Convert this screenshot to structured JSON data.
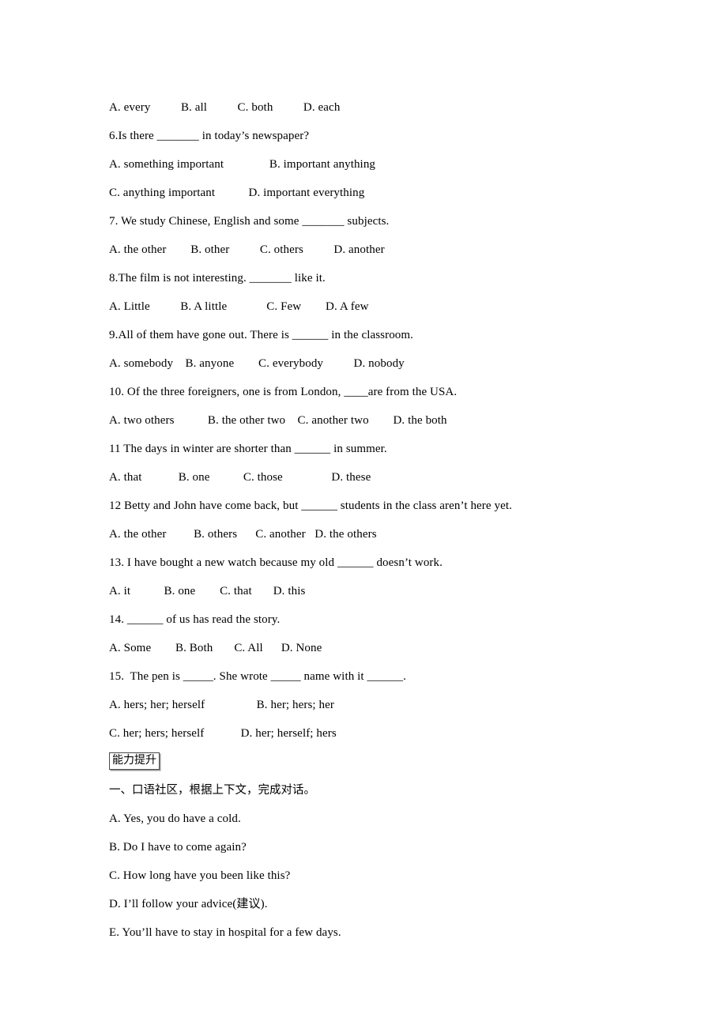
{
  "document": {
    "type": "english-grammar-worksheet",
    "background": "#ffffff",
    "text_color": "#000000"
  },
  "questions": [
    {
      "id": "q5-options",
      "kind": "options",
      "text": "A. every          B. all          C. both          D. each"
    },
    {
      "id": "q6",
      "kind": "stem",
      "text": "6.Is there _______ in today’s newspaper?"
    },
    {
      "id": "q6-options-1",
      "kind": "options",
      "text": "A. something important               B. important anything"
    },
    {
      "id": "q6-options-2",
      "kind": "options",
      "text": "C. anything important           D. important everything"
    },
    {
      "id": "q7",
      "kind": "stem",
      "text": "7. We study Chinese, English and some _______ subjects."
    },
    {
      "id": "q7-options",
      "kind": "options",
      "text": "A. the other        B. other          C. others          D. another"
    },
    {
      "id": "q8",
      "kind": "stem",
      "text": "8.The film is not interesting. _______ like it."
    },
    {
      "id": "q8-options",
      "kind": "options",
      "text": "A. Little          B. A little             C. Few        D. A few"
    },
    {
      "id": "q9",
      "kind": "stem",
      "text": "9.All of them have gone out. There is ______ in the classroom."
    },
    {
      "id": "q9-options",
      "kind": "options",
      "text": "A. somebody    B. anyone        C. everybody          D. nobody"
    },
    {
      "id": "q10",
      "kind": "stem",
      "text": "10. Of the three foreigners, one is from London, ____are from the USA."
    },
    {
      "id": "q10-options",
      "kind": "options",
      "text": "A. two others           B. the other two    C. another two        D. the both"
    },
    {
      "id": "q11",
      "kind": "stem",
      "text": "11 The days in winter are shorter than ______ in summer."
    },
    {
      "id": "q11-options",
      "kind": "options",
      "text": "A. that            B. one           C. those                D. these"
    },
    {
      "id": "q12",
      "kind": "stem",
      "text": "12 Betty and John have come back, but ______ students in the class aren’t here yet."
    },
    {
      "id": "q12-options",
      "kind": "options",
      "text": "A. the other         B. others      C. another   D. the others"
    },
    {
      "id": "q13",
      "kind": "stem",
      "text": "13. I have bought a new watch because my old ______ doesn’t work."
    },
    {
      "id": "q13-options",
      "kind": "options",
      "text": "A. it           B. one        C. that       D. this"
    },
    {
      "id": "q14",
      "kind": "stem",
      "text": "14. ______ of us has read the story."
    },
    {
      "id": "q14-options",
      "kind": "options",
      "text": "A. Some        B. Both       C. All      D. None"
    },
    {
      "id": "q15",
      "kind": "stem",
      "text": "15.  The pen is _____. She wrote _____ name with it ______."
    },
    {
      "id": "q15-options-1",
      "kind": "options",
      "text": "A. hers; her; herself                 B. her; hers; her"
    },
    {
      "id": "q15-options-2",
      "kind": "options",
      "text": "C. her; hers; herself            D. her; herself; hers"
    }
  ],
  "section": {
    "tag_label": "能力提升",
    "heading": "一、口语社区，根据上下文，完成对话。"
  },
  "dialogue_options": [
    {
      "id": "dlg-a",
      "text": "A. Yes, you do have a cold."
    },
    {
      "id": "dlg-b",
      "text": "B. Do I have to come again?"
    },
    {
      "id": "dlg-c",
      "text": "C. How long have you been like this?"
    },
    {
      "id": "dlg-d",
      "text": "D. I’ll follow your advice(建议)."
    },
    {
      "id": "dlg-e",
      "text": "E. You’ll have to stay in hospital for a few days."
    }
  ]
}
